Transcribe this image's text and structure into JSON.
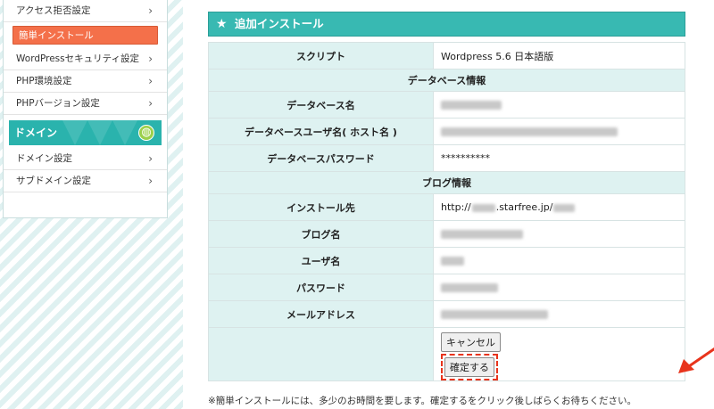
{
  "sidebar": {
    "top_items": [
      {
        "label": "アクセス拒否設定"
      },
      {
        "label": "簡単インストール"
      },
      {
        "label": "WordPressセキュリティ設定"
      },
      {
        "label": "PHP環境設定"
      },
      {
        "label": "PHPバージョン設定"
      }
    ],
    "domain_header": "ドメイン",
    "domain_items": [
      {
        "label": "ドメイン設定"
      },
      {
        "label": "サブドメイン設定"
      }
    ]
  },
  "panel": {
    "title": "追加インストール",
    "script_label": "スクリプト",
    "script_value": "Wordpress 5.6 日本語版",
    "db_section": "データベース情報",
    "db_name_label": "データベース名",
    "db_user_label": "データベースユーザ名( ホスト名 )",
    "db_pass_label": "データベースパスワード",
    "db_pass_value": "**********",
    "blog_section": "ブログ情報",
    "install_to_label": "インストール先",
    "install_url_prefix": "http://",
    "install_url_mid": ".starfree.jp/",
    "blog_name_label": "ブログ名",
    "user_label": "ユーザ名",
    "password_label": "パスワード",
    "email_label": "メールアドレス",
    "cancel_button": "キャンセル",
    "confirm_button": "確定する",
    "note": "※簡単インストールには、多少のお時間を要します。確定するをクリック後しばらくお待ちください。"
  },
  "colors": {
    "accent": "#38b9b2",
    "active_item": "#f4704a",
    "highlight": "#e8341c",
    "label_bg": "#def2f1"
  }
}
